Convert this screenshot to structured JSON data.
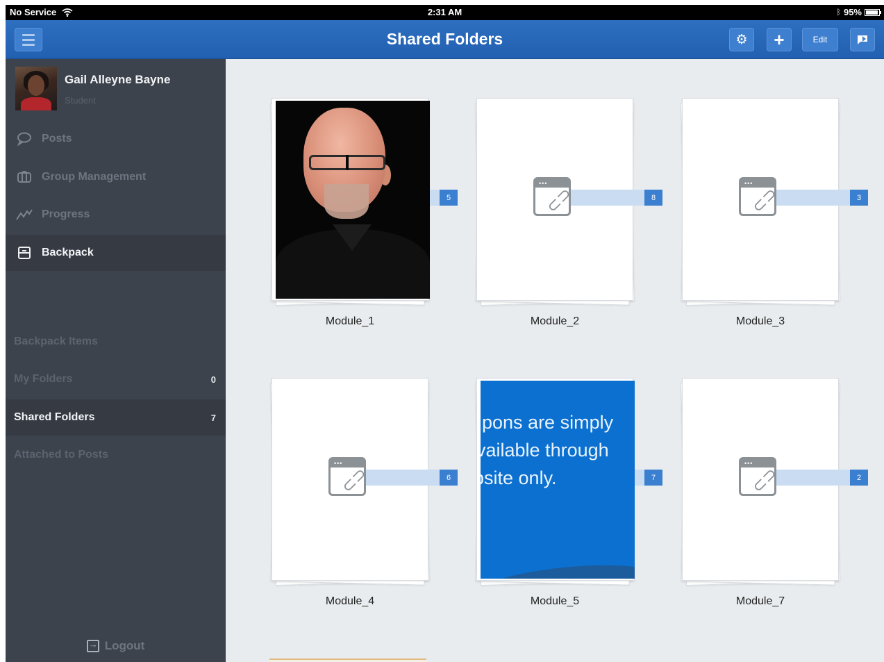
{
  "status_bar": {
    "carrier": "No Service",
    "time": "2:31 AM",
    "battery": "95%",
    "battery_level": 0.95
  },
  "navbar": {
    "title": "Shared Folders",
    "edit_label": "Edit",
    "icons": [
      "menu-icon",
      "gear-icon",
      "plus-icon",
      "share-icon"
    ]
  },
  "sidebar": {
    "user": {
      "name": "Gail Alleyne Bayne",
      "role": "Student"
    },
    "nav": [
      {
        "label": "Posts",
        "icon": "speech-bubble-icon",
        "active": false
      },
      {
        "label": "Group Management",
        "icon": "group-icon",
        "active": false
      },
      {
        "label": "Progress",
        "icon": "chart-line-icon",
        "active": false
      },
      {
        "label": "Backpack",
        "icon": "backpack-icon",
        "active": true
      }
    ],
    "section_title": "Backpack Items",
    "backpack_items": [
      {
        "label": "My Folders",
        "count": "0",
        "active": false
      },
      {
        "label": "Shared Folders",
        "count": "7",
        "active": true
      },
      {
        "label": "Attached to Posts",
        "count": "",
        "active": false
      }
    ],
    "logout_label": "Logout"
  },
  "folders": [
    {
      "name": "Module_1",
      "count": "5",
      "cover": "photo"
    },
    {
      "name": "Module_2",
      "count": "8",
      "cover": "link"
    },
    {
      "name": "Module_3",
      "count": "3",
      "cover": "link"
    },
    {
      "name": "Module_4",
      "count": "6",
      "cover": "link"
    },
    {
      "name": "Module_5",
      "count": "7",
      "cover": "text",
      "cover_lines": [
        "pons are simply",
        "vailable through",
        "bsite only."
      ]
    },
    {
      "name": "Module_7",
      "count": "2",
      "cover": "link"
    }
  ],
  "colors": {
    "navbar": "#2567b7",
    "sidebar": "#3d434d",
    "accent_badge": "#3a7fd0",
    "content_bg": "#e9ecef"
  }
}
